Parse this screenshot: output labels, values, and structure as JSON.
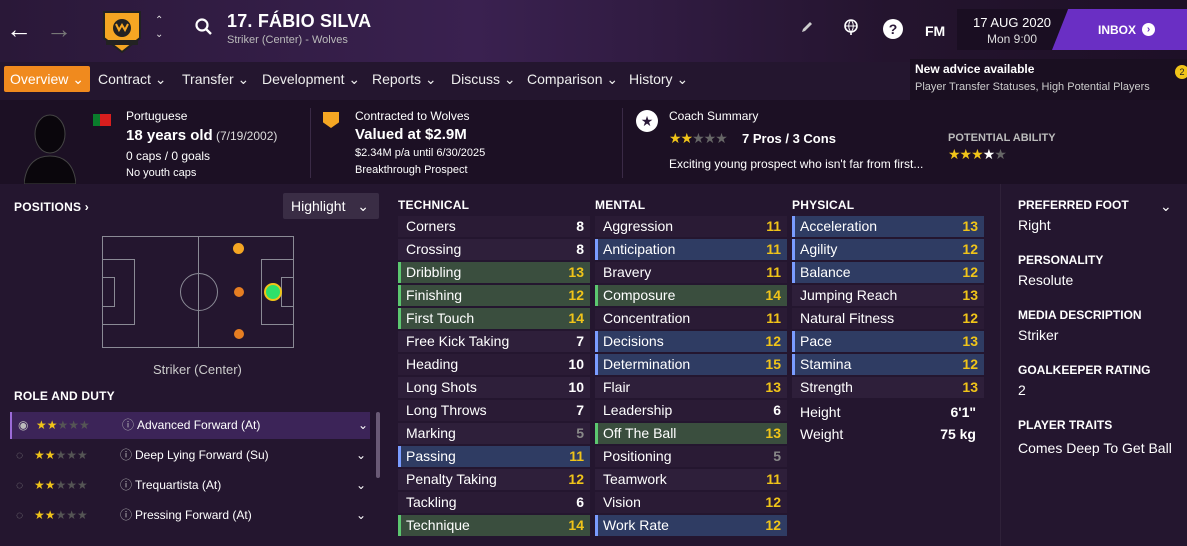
{
  "header": {
    "player_name": "17. FÁBIO SILVA",
    "subtitle": "Striker (Center) - Wolves",
    "date": "17 AUG 2020",
    "time": "Mon 9:00",
    "fm_label": "FM",
    "inbox_label": "INBOX"
  },
  "tabs": [
    {
      "label": "Overview ⌄"
    },
    {
      "label": "Contract ⌄"
    },
    {
      "label": "Transfer ⌄"
    },
    {
      "label": "Development ⌄"
    },
    {
      "label": "Reports ⌄"
    },
    {
      "label": "Discuss ⌄"
    },
    {
      "label": "Comparison ⌄"
    },
    {
      "label": "History ⌄"
    }
  ],
  "advice": {
    "title": "New advice available",
    "subtitle": "Player Transfer Statuses, High Potential Players",
    "badge": "2"
  },
  "info": {
    "nationality": "Portuguese",
    "age": "18 years old",
    "dob": "(7/19/2002)",
    "caps": "0 caps / 0 goals",
    "youth": "No youth caps",
    "contract_club": "Contracted to Wolves",
    "value": "Valued at $2.9M",
    "wage": "$2.34M p/a until 6/30/2025",
    "status": "Breakthrough Prospect",
    "coach_title": "Coach Summary",
    "pros_cons": "7 Pros / 3 Cons",
    "coach_text": "Exciting young prospect who isn't far from first...",
    "potential_label": "POTENTIAL ABILITY"
  },
  "positions": {
    "title": "POSITIONS",
    "highlight": "Highlight",
    "position_label": "Striker (Center)"
  },
  "role": {
    "title": "ROLE AND DUTY",
    "items": [
      {
        "label": "Advanced Forward (At)"
      },
      {
        "label": "Deep Lying Forward (Su)"
      },
      {
        "label": "Trequartista (At)"
      },
      {
        "label": "Pressing Forward (At)"
      }
    ]
  },
  "technical": {
    "title": "TECHNICAL",
    "attrs": [
      {
        "name": "Corners",
        "value": "8"
      },
      {
        "name": "Crossing",
        "value": "8"
      },
      {
        "name": "Dribbling",
        "value": "13"
      },
      {
        "name": "Finishing",
        "value": "12"
      },
      {
        "name": "First Touch",
        "value": "14"
      },
      {
        "name": "Free Kick Taking",
        "value": "7"
      },
      {
        "name": "Heading",
        "value": "10"
      },
      {
        "name": "Long Shots",
        "value": "10"
      },
      {
        "name": "Long Throws",
        "value": "7"
      },
      {
        "name": "Marking",
        "value": "5"
      },
      {
        "name": "Passing",
        "value": "11"
      },
      {
        "name": "Penalty Taking",
        "value": "12"
      },
      {
        "name": "Tackling",
        "value": "6"
      },
      {
        "name": "Technique",
        "value": "14"
      }
    ]
  },
  "mental": {
    "title": "MENTAL",
    "attrs": [
      {
        "name": "Aggression",
        "value": "11"
      },
      {
        "name": "Anticipation",
        "value": "11"
      },
      {
        "name": "Bravery",
        "value": "11"
      },
      {
        "name": "Composure",
        "value": "14"
      },
      {
        "name": "Concentration",
        "value": "11"
      },
      {
        "name": "Decisions",
        "value": "12"
      },
      {
        "name": "Determination",
        "value": "15"
      },
      {
        "name": "Flair",
        "value": "13"
      },
      {
        "name": "Leadership",
        "value": "6"
      },
      {
        "name": "Off The Ball",
        "value": "13"
      },
      {
        "name": "Positioning",
        "value": "5"
      },
      {
        "name": "Teamwork",
        "value": "11"
      },
      {
        "name": "Vision",
        "value": "12"
      },
      {
        "name": "Work Rate",
        "value": "12"
      }
    ]
  },
  "physical": {
    "title": "PHYSICAL",
    "attrs": [
      {
        "name": "Acceleration",
        "value": "13"
      },
      {
        "name": "Agility",
        "value": "12"
      },
      {
        "name": "Balance",
        "value": "12"
      },
      {
        "name": "Jumping Reach",
        "value": "13"
      },
      {
        "name": "Natural Fitness",
        "value": "12"
      },
      {
        "name": "Pace",
        "value": "13"
      },
      {
        "name": "Stamina",
        "value": "12"
      },
      {
        "name": "Strength",
        "value": "13"
      }
    ],
    "height_label": "Height",
    "height": "6'1\"",
    "weight_label": "Weight",
    "weight": "75 kg"
  },
  "profile": {
    "foot_label": "PREFERRED FOOT",
    "foot": "Right",
    "personality_label": "PERSONALITY",
    "personality": "Resolute",
    "media_label": "MEDIA DESCRIPTION",
    "media": "Striker",
    "gk_label": "GOALKEEPER RATING",
    "gk": "2",
    "traits_label": "PLAYER TRAITS",
    "traits": "Comes Deep To Get Ball"
  },
  "colors": {
    "accent": "#f08a1e",
    "inbox": "#6a2fc4",
    "star": "#f0c419"
  }
}
